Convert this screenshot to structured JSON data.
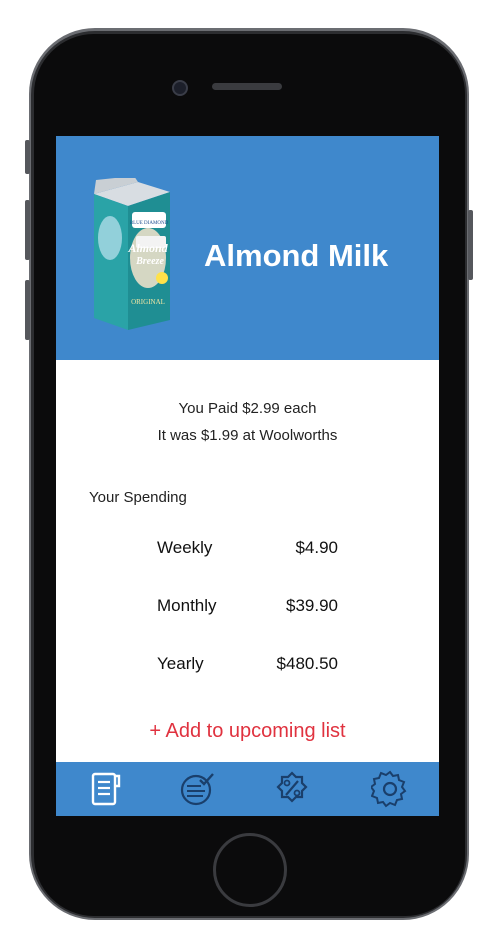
{
  "product": {
    "name": "Almond Milk",
    "image_icon": "almond-milk-carton",
    "carton_brand": "Almond Breeze",
    "carton_maker": "BLUE DIAMOND ALMONDS",
    "carton_variant": "ORIGINAL"
  },
  "price_info": {
    "paid": "You Paid $2.99 each",
    "comparison": "It was $1.99 at Woolworths"
  },
  "spending": {
    "title": "Your Spending",
    "rows": [
      {
        "label": "Weekly",
        "value": "$4.90"
      },
      {
        "label": "Monthly",
        "value": "$39.90"
      },
      {
        "label": "Yearly",
        "value": "$480.50"
      }
    ]
  },
  "actions": {
    "add_label": "+ Add to upcoming list"
  },
  "tabbar": {
    "items": [
      {
        "icon": "receipt-icon",
        "active": true
      },
      {
        "icon": "checklist-icon",
        "active": false
      },
      {
        "icon": "discount-icon",
        "active": false
      },
      {
        "icon": "settings-icon",
        "active": false
      }
    ]
  },
  "colors": {
    "accent": "#3f88cc",
    "add_link": "#e0323f",
    "active_tab_icon": "#ffffff",
    "inactive_tab_icon": "#1a3f6b"
  }
}
